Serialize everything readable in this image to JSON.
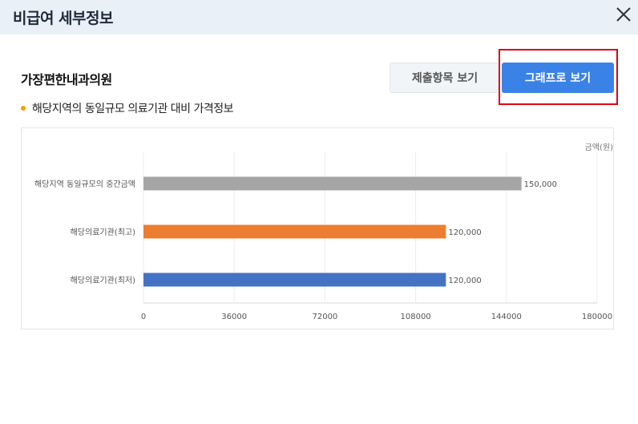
{
  "header": {
    "title": "비급여 세부정보"
  },
  "clinic": {
    "name": "가장편한내과의원"
  },
  "buttons": {
    "items_label": "제출항목 보기",
    "graph_label": "그래프로 보기"
  },
  "subtitle": "해당지역의 동일규모 의료기관 대비 가격정보",
  "icons": {
    "close": "close-icon",
    "bullet": "bullet-icon"
  },
  "colors": {
    "highlight": "#e3000f",
    "primary_button": "#3b82e6",
    "bullet": "#f5a000"
  },
  "chart_data": {
    "type": "bar",
    "orientation": "horizontal",
    "categories": [
      "해당지역 동일규모의 중간금액",
      "해당의료기관(최고)",
      "해당의료기관(최저)"
    ],
    "values": [
      150000,
      120000,
      120000
    ],
    "value_labels": [
      "150,000",
      "120,000",
      "120,000"
    ],
    "bar_colors": [
      "#a5a5a5",
      "#ed7d31",
      "#4472c4"
    ],
    "unit_label": "금액(원)",
    "xlim": [
      0,
      180000
    ],
    "xticks": [
      0,
      36000,
      72000,
      108000,
      144000,
      180000
    ],
    "xtick_labels": [
      "0",
      "36000",
      "72000",
      "108000",
      "144000",
      "180000"
    ],
    "grid": true
  }
}
